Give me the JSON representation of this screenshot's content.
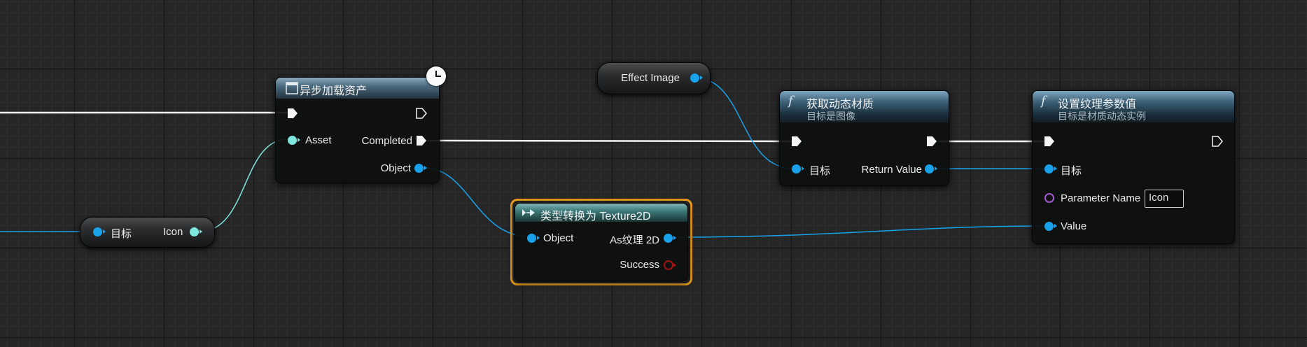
{
  "graph": {
    "async_load": {
      "title": "异步加载资产",
      "pins": {
        "asset": "Asset",
        "completed": "Completed",
        "object": "Object"
      }
    },
    "target_icon_node": {
      "target": "目标",
      "output": "Icon"
    },
    "effect_image_node": {
      "label": "Effect Image"
    },
    "get_dynamic_material": {
      "title": "获取动态材质",
      "subtitle": "目标是图像",
      "pins": {
        "target": "目标",
        "return_value": "Return Value"
      }
    },
    "cast_texture2d": {
      "title": "类型转换为 Texture2D",
      "pins": {
        "object": "Object",
        "as_texture": "As纹理 2D",
        "success": "Success"
      }
    },
    "set_texture_param": {
      "title": "设置纹理参数值",
      "subtitle": "目标是材质动态实例",
      "pins": {
        "target": "目标",
        "parameter_name": "Parameter Name",
        "parameter_value": "Icon",
        "value": "Value"
      }
    }
  },
  "colors": {
    "exec_wire": "#f4f4f4",
    "object_wire": "#19a2ec",
    "class_wire": "#7ee8e0",
    "selection": "#f0a020",
    "header_blue": "#3b6077",
    "header_teal": "#3d7a7a"
  },
  "icons": [
    "function-icon",
    "clock-icon",
    "cast-icon",
    "macro-icon",
    "exec-pin-icon"
  ]
}
